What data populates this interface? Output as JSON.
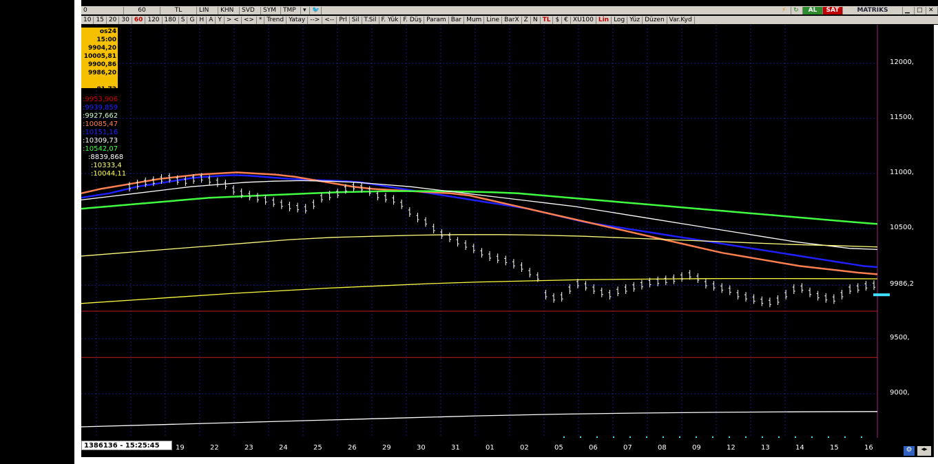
{
  "toolbar1": {
    "items": [
      "0",
      "60",
      "TL",
      "LIN",
      "KHN",
      "SVD",
      "SYM",
      "TMP"
    ],
    "al_label": "AL",
    "sat_label": "SAT",
    "brand": "MATRIKS"
  },
  "toolbar2": {
    "periods": [
      "10",
      "15",
      "20",
      "30",
      "60",
      "120",
      "180",
      "S",
      "G",
      "H",
      "A",
      "Y"
    ],
    "active_period": "60",
    "tools": [
      "> <",
      "<>",
      "*",
      "Trend",
      "Yatay",
      "-->",
      "<--",
      "Prl",
      "Sil",
      "T.Sil",
      "F. Yük",
      "F. Düş",
      "Param",
      "Bar",
      "Mum",
      "Line",
      "BarX",
      "Z",
      "N",
      "TL",
      "$",
      "€",
      "XU100",
      "Lin",
      "Log",
      "Yüz",
      "Düzen",
      "Var.Kyd"
    ]
  },
  "info_box": {
    "date": "os24 15:00",
    "open": "9904,20",
    "high": "10005,81",
    "low": "9900,86",
    "close": "9986,20",
    "volume": "81,72"
  },
  "indicators": [
    {
      "text": ":9953,906",
      "color": "#d00000"
    },
    {
      "text": ":9939,859",
      "color": "#2020ff"
    },
    {
      "text": ":9927,662",
      "color": "#d0ffd0"
    },
    {
      "text": ":10085,47",
      "color": "#ff7f50"
    },
    {
      "text": ":10151,16",
      "color": "#2020ff"
    },
    {
      "text": ":10309,73",
      "color": "#ffffff"
    },
    {
      "text": ":10542,07",
      "color": "#40ff40"
    },
    {
      "text": ":8839,868",
      "color": "#ffffff"
    },
    {
      "text": ":10333,4",
      "color": "#ffff80"
    },
    {
      "text": ":10044,11",
      "color": "#ffff40"
    }
  ],
  "status": {
    "text": "1386136 - 15:25:45"
  },
  "chart_data": {
    "type": "line",
    "title": "",
    "y_ticks": [
      "12000,",
      "11500,",
      "11000,",
      "10500,",
      "9986,2",
      "9500,",
      "9000,"
    ],
    "y_tick_values": [
      12000,
      11500,
      11000,
      10500,
      9986.2,
      9500,
      9000
    ],
    "ylim": [
      8600,
      12350
    ],
    "last_price_label": "9986,2",
    "x_ticks": [
      "19",
      "22",
      "23",
      "24",
      "25",
      "26",
      "29",
      "30",
      "31",
      "01",
      "02",
      "05",
      "06",
      "07",
      "08",
      "09",
      "12",
      "13",
      "14",
      "15",
      "16"
    ],
    "horizontal_lines": [
      9750,
      9330
    ],
    "price": [
      10880,
      10900,
      10920,
      10930,
      10950,
      10960,
      10940,
      10930,
      10950,
      10960,
      10940,
      10920,
      10900,
      10850,
      10820,
      10800,
      10780,
      10760,
      10740,
      10720,
      10700,
      10690,
      10680,
      10720,
      10780,
      10800,
      10820,
      10860,
      10880,
      10870,
      10840,
      10800,
      10780,
      10760,
      10720,
      10650,
      10600,
      10560,
      10500,
      10450,
      10420,
      10380,
      10350,
      10320,
      10280,
      10250,
      10230,
      10210,
      10180,
      10150,
      10100,
      10060,
      9900,
      9870,
      9880,
      9950,
      10000,
      9980,
      9950,
      9920,
      9900,
      9930,
      9950,
      9970,
      9990,
      10010,
      10020,
      10030,
      10040,
      10060,
      10080,
      10050,
      10000,
      9980,
      9960,
      9940,
      9900,
      9880,
      9860,
      9840,
      9830,
      9850,
      9900,
      9950,
      9960,
      9920,
      9890,
      9870,
      9860,
      9900,
      9950,
      9960,
      9980,
      9986
    ],
    "series": [
      {
        "name": "",
        "color": "#2020ff",
        "values": [
          10780,
          10800,
          10820,
          10850,
          10880,
          10900,
          10920,
          10940,
          10960,
          10970,
          10980,
          10985,
          10980,
          10970,
          10960,
          10950,
          10945,
          10940,
          10935,
          10930,
          10920,
          10900,
          10880,
          10860,
          10840,
          10820,
          10800,
          10780,
          10760,
          10740,
          10720,
          10700,
          10680,
          10650,
          10620,
          10590,
          10560,
          10540,
          10520,
          10500,
          10480,
          10460,
          10440,
          10420,
          10400,
          10380,
          10360,
          10340,
          10320,
          10300,
          10280,
          10260,
          10240,
          10220,
          10200,
          10180,
          10160,
          10150
        ]
      },
      {
        "name": "",
        "color": "#ff7f50",
        "values": [
          10820,
          10860,
          10890,
          10920,
          10950,
          10970,
          10990,
          11000,
          11010,
          11000,
          10990,
          10970,
          10940,
          10910,
          10880,
          10860,
          10850,
          10840,
          10830,
          10820,
          10800,
          10760,
          10720,
          10680,
          10640,
          10600,
          10560,
          10520,
          10480,
          10440,
          10400,
          10360,
          10320,
          10280,
          10250,
          10220,
          10190,
          10160,
          10140,
          10120,
          10100,
          10085
        ]
      },
      {
        "name": "",
        "color": "#40ff40",
        "values": [
          10680,
          10700,
          10720,
          10740,
          10760,
          10780,
          10790,
          10800,
          10810,
          10820,
          10830,
          10835,
          10840,
          10840,
          10840,
          10835,
          10830,
          10820,
          10800,
          10780,
          10760,
          10740,
          10720,
          10700,
          10680,
          10660,
          10640,
          10620,
          10600,
          10580,
          10560,
          10542
        ]
      },
      {
        "name": "",
        "color": "#ffffff",
        "values": [
          10760,
          10790,
          10820,
          10850,
          10880,
          10900,
          10920,
          10930,
          10935,
          10930,
          10920,
          10900,
          10880,
          10850,
          10820,
          10790,
          10760,
          10730,
          10700,
          10660,
          10620,
          10580,
          10540,
          10500,
          10460,
          10420,
          10380,
          10350,
          10320,
          10310
        ]
      },
      {
        "name": "",
        "color": "#ffff80",
        "values": [
          10250,
          10280,
          10310,
          10340,
          10370,
          10400,
          10420,
          10430,
          10440,
          10445,
          10445,
          10440,
          10430,
          10415,
          10400,
          10385,
          10370,
          10355,
          10345,
          10333
        ]
      },
      {
        "name": "",
        "color": "#ffff40",
        "values": [
          9820,
          9850,
          9880,
          9910,
          9935,
          9960,
          9980,
          10000,
          10015,
          10025,
          10035,
          10040,
          10044,
          10046,
          10046,
          10045,
          10044
        ]
      },
      {
        "name": "",
        "color": "#ffffff",
        "values": [
          8700,
          8720,
          8740,
          8760,
          8780,
          8800,
          8815,
          8825,
          8832,
          8836,
          8839
        ]
      }
    ]
  }
}
